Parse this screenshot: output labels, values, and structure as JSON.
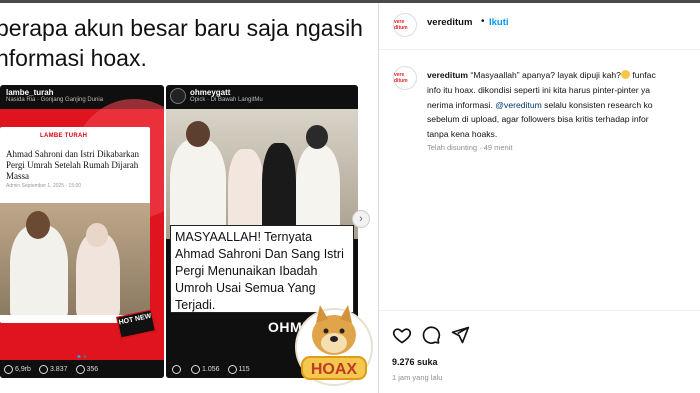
{
  "headline": {
    "line1": "berapa akun besar baru saja ngasih",
    "line2": "nformasi hoax."
  },
  "left_post": {
    "account": "lambe_turah",
    "sub": "Nasida Ria · Gonjang Ganjing Dunia",
    "logo": "LAMBE TURAH",
    "article_title": "Ahmad Sahroni dan Istri Dikabarkan Pergi Umrah Setelah Rumah Dijarah Massa",
    "article_meta": "Admin   September 1, 2025 · 15:00",
    "badge": "HOT NEW",
    "stats": {
      "likes": "6,9rb",
      "comments": "3.837",
      "reposts": "356"
    }
  },
  "right_post": {
    "account": "ohmeygatt",
    "sub": "Opick · Di Bawah LangitMu",
    "caption": "MASYAALLAH! Ternyata Ahmad Sahroni Dan Sang Istri Pergi Menunaikan Ibadah Umroh Usai Semua Yang Terjadi.",
    "watermark": "OHMEY",
    "stats": {
      "comments": "1.056",
      "reposts": "115"
    }
  },
  "stamp": "HOAX",
  "panel": {
    "avatar_text": "vere ditum",
    "username": "vereditum",
    "dot": "•",
    "follow": "Ikuti",
    "comment": {
      "username": "vereditum",
      "line1_rest": " “Masyaallah” apanya? layak dipuji kah?",
      "line1_tail": " funfac",
      "line2": "info itu hoax. dikondisi seperti ini kita harus pinter-pinter ya",
      "line3": "nerima informasi. ",
      "mention": "@vereditum",
      "line3_rest": " selalu konsisten research ko",
      "line4": "sebelum di upload, agar followers bisa kritis terhadap infor",
      "line5": "tanpa kena hoaks.",
      "meta": "Telah disunting · 49 menit"
    },
    "likes": "9.276 suka",
    "time": "1 jam yang lalu"
  },
  "colors": {
    "follow": "#0095f6",
    "brand_red": "#e0141e",
    "mention": "#00376b"
  },
  "icons": [
    "heart-icon",
    "comment-icon",
    "share-icon",
    "chevron-right-icon"
  ]
}
